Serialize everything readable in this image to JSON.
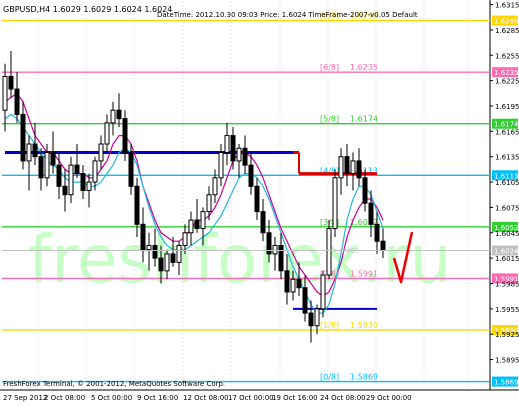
{
  "header": {
    "symbol_info": "GBPUSD,H4  1.6029 1.6029 1.6024 1.6024",
    "indicator_info": "DateTime: 2012.10.30 09:03   Price: 1.6024   TimeFrame-2007-v0.05   Default"
  },
  "footer": {
    "copyright": "FreshForex Terminal, © 2001-2012, MetaQuotes Software Corp."
  },
  "watermark": "freshforex.ru",
  "colors": {
    "background": "#ffffff",
    "candle_bull": "#000000",
    "candle_bear": "#000000",
    "level_8_8": "#ffd700",
    "level_7_8": "#ffd700",
    "level_6_8": "#ff69b4",
    "level_5_8": "#32cd32",
    "level_4_8": "#00bfff",
    "level_3_8": "#32cd32",
    "level_2_8": "#ff69b4",
    "level_1_8": "#ffd700",
    "level_0_8": "#00bfff",
    "thick_blue": "#0000cd",
    "thick_red": "#dd0000",
    "line_magenta": "#cc0099",
    "line_cyan": "#22bbdd",
    "watermark": "#7fff7f",
    "arrow": "#ee0000",
    "price_label_text": "#ffffff"
  },
  "chart_data": {
    "type": "candlestick",
    "y_range": [
      1.5859,
      1.6318
    ],
    "price_axis_ticks": [
      "1.6315",
      "1.6285",
      "1.6255",
      "1.6225",
      "1.6195",
      "1.6165",
      "1.6135",
      "1.6105",
      "1.6075",
      "1.6045",
      "1.6015",
      "1.5985",
      "1.5955",
      "1.5925",
      "1.5895"
    ],
    "time_axis_labels": [
      "27 Sep 2012",
      "2 Oct 08:00",
      "5 Oct 00:00",
      "9 Oct 16:00",
      "12 Oct 08:00",
      "17 Oct 00:00",
      "19 Oct 16:00",
      "24 Oct 08:00",
      "29 Oct 00:00"
    ],
    "murrey_levels": [
      {
        "label": "[8/8]",
        "value": "1.6296",
        "price_label": "1.6296",
        "color_key": "level_8_8"
      },
      {
        "label": "[6/8]",
        "value": "1.6235",
        "price_label": "1.6235",
        "color_key": "level_6_8"
      },
      {
        "label": "[5/8]",
        "value": "1.6174",
        "price_label": "1.6174",
        "color_key": "level_5_8"
      },
      {
        "label": "[4/8]",
        "value": "1.6113",
        "price_label": "1.6113",
        "color_key": "level_4_8"
      },
      {
        "label": "[3/8]",
        "value": "1.6052",
        "price_label": "1.6052",
        "color_key": "level_3_8"
      },
      {
        "label": "[2/8]",
        "value": "1.5991",
        "price_label": "1.5991",
        "color_key": "level_2_8"
      },
      {
        "label": "[1/8]",
        "value": "1.5930",
        "price_label": "1.5930",
        "color_key": "level_1_8"
      },
      {
        "label": "[0/8]",
        "value": "1.5869",
        "price_label": "1.5869",
        "color_key": "level_0_8"
      }
    ],
    "current_price_label": "1.6024",
    "close_label": "Close",
    "candles": [
      [
        1.619,
        1.6245,
        1.6165,
        1.623
      ],
      [
        1.623,
        1.626,
        1.6205,
        1.6215
      ],
      [
        1.6215,
        1.6235,
        1.6175,
        1.6185
      ],
      [
        1.6185,
        1.62,
        1.612,
        1.613
      ],
      [
        1.613,
        1.616,
        1.6095,
        1.615
      ],
      [
        1.615,
        1.6175,
        1.6125,
        1.6135
      ],
      [
        1.6135,
        1.6145,
        1.6095,
        1.611
      ],
      [
        1.611,
        1.615,
        1.61,
        1.614
      ],
      [
        1.614,
        1.6165,
        1.6115,
        1.6125
      ],
      [
        1.6125,
        1.614,
        1.6085,
        1.61
      ],
      [
        1.61,
        1.612,
        1.607,
        1.609
      ],
      [
        1.609,
        1.6135,
        1.608,
        1.6125
      ],
      [
        1.6125,
        1.615,
        1.611,
        1.6115
      ],
      [
        1.6115,
        1.6125,
        1.6085,
        1.6095
      ],
      [
        1.6095,
        1.6115,
        1.6075,
        1.6105
      ],
      [
        1.6105,
        1.6135,
        1.6095,
        1.613
      ],
      [
        1.613,
        1.616,
        1.612,
        1.615
      ],
      [
        1.615,
        1.6185,
        1.614,
        1.6175
      ],
      [
        1.6175,
        1.62,
        1.616,
        1.619
      ],
      [
        1.619,
        1.621,
        1.617,
        1.618
      ],
      [
        1.618,
        1.619,
        1.613,
        1.614
      ],
      [
        1.614,
        1.615,
        1.609,
        1.61
      ],
      [
        1.61,
        1.611,
        1.604,
        1.6055
      ],
      [
        1.6055,
        1.6075,
        1.601,
        1.6025
      ],
      [
        1.6025,
        1.6045,
        1.6,
        1.603
      ],
      [
        1.603,
        1.605,
        1.6005,
        1.6015
      ],
      [
        1.6015,
        1.603,
        1.5985,
        1.6
      ],
      [
        1.6,
        1.6025,
        1.599,
        1.602
      ],
      [
        1.602,
        1.604,
        1.6005,
        1.601
      ],
      [
        1.601,
        1.6035,
        1.5995,
        1.603
      ],
      [
        1.603,
        1.6055,
        1.602,
        1.6045
      ],
      [
        1.6045,
        1.607,
        1.603,
        1.606
      ],
      [
        1.606,
        1.6085,
        1.6045,
        1.605
      ],
      [
        1.605,
        1.6075,
        1.603,
        1.607
      ],
      [
        1.607,
        1.61,
        1.606,
        1.609
      ],
      [
        1.609,
        1.612,
        1.608,
        1.611
      ],
      [
        1.611,
        1.615,
        1.61,
        1.614
      ],
      [
        1.614,
        1.6175,
        1.6125,
        1.616
      ],
      [
        1.616,
        1.617,
        1.612,
        1.613
      ],
      [
        1.613,
        1.615,
        1.611,
        1.6145
      ],
      [
        1.6145,
        1.616,
        1.6115,
        1.6125
      ],
      [
        1.6125,
        1.614,
        1.609,
        1.61
      ],
      [
        1.61,
        1.611,
        1.606,
        1.607
      ],
      [
        1.607,
        1.6085,
        1.6035,
        1.6045
      ],
      [
        1.6045,
        1.606,
        1.601,
        1.602
      ],
      [
        1.602,
        1.604,
        1.6,
        1.603
      ],
      [
        1.603,
        1.6045,
        1.599,
        1.6
      ],
      [
        1.6,
        1.602,
        1.596,
        1.5975
      ],
      [
        1.5975,
        1.6,
        1.5965,
        1.599
      ],
      [
        1.599,
        1.601,
        1.597,
        1.598
      ],
      [
        1.598,
        1.5995,
        1.594,
        1.595
      ],
      [
        1.595,
        1.5965,
        1.5915,
        1.5935
      ],
      [
        1.5935,
        1.596,
        1.5925,
        1.5955
      ],
      [
        1.5955,
        1.6,
        1.5945,
        1.5995
      ],
      [
        1.5995,
        1.606,
        1.599,
        1.605
      ],
      [
        1.605,
        1.612,
        1.604,
        1.611
      ],
      [
        1.611,
        1.6145,
        1.609,
        1.6135
      ],
      [
        1.6135,
        1.615,
        1.61,
        1.6115
      ],
      [
        1.6115,
        1.614,
        1.6095,
        1.613
      ],
      [
        1.613,
        1.6145,
        1.61,
        1.611
      ],
      [
        1.611,
        1.612,
        1.607,
        1.608
      ],
      [
        1.608,
        1.6095,
        1.604,
        1.6055
      ],
      [
        1.6055,
        1.607,
        1.602,
        1.6035
      ],
      [
        1.6035,
        1.605,
        1.6015,
        1.6025
      ]
    ],
    "ma_magenta": [
      1.62,
      1.6205,
      1.621,
      1.62,
      1.618,
      1.616,
      1.615,
      1.614,
      1.614,
      1.613,
      1.612,
      1.6115,
      1.6115,
      1.6115,
      1.611,
      1.611,
      1.612,
      1.613,
      1.615,
      1.616,
      1.616,
      1.615,
      1.613,
      1.61,
      1.608,
      1.606,
      1.6045,
      1.604,
      1.6035,
      1.6035,
      1.604,
      1.605,
      1.606,
      1.606,
      1.6065,
      1.6075,
      1.609,
      1.611,
      1.613,
      1.614,
      1.614,
      1.6135,
      1.6125,
      1.611,
      1.609,
      1.607,
      1.605,
      1.6035,
      1.602,
      1.6005,
      1.5995,
      1.5985,
      1.5975,
      1.597,
      1.5975,
      1.599,
      1.601,
      1.604,
      1.606,
      1.6075,
      1.6085,
      1.6085,
      1.6075,
      1.606
    ],
    "ma_cyan": [
      1.618,
      1.6185,
      1.618,
      1.617,
      1.616,
      1.615,
      1.614,
      1.613,
      1.6125,
      1.612,
      1.611,
      1.6105,
      1.6105,
      1.6105,
      1.61,
      1.61,
      1.6105,
      1.6115,
      1.6125,
      1.614,
      1.6145,
      1.614,
      1.6125,
      1.61,
      1.6075,
      1.6055,
      1.604,
      1.603,
      1.6025,
      1.6025,
      1.6025,
      1.603,
      1.6035,
      1.604,
      1.6045,
      1.6055,
      1.6065,
      1.608,
      1.6095,
      1.611,
      1.6115,
      1.6115,
      1.611,
      1.61,
      1.6085,
      1.6065,
      1.6045,
      1.6025,
      1.6005,
      1.599,
      1.5975,
      1.596,
      1.595,
      1.595,
      1.596,
      1.5985,
      1.602,
      1.606,
      1.6085,
      1.61,
      1.61,
      1.609,
      1.607,
      1.605
    ],
    "thick_lines": [
      {
        "color_key": "thick_blue",
        "segments": [
          {
            "x0": 0,
            "x1": 48,
            "y": 1.614
          }
        ]
      },
      {
        "color_key": "thick_red",
        "segments": [
          {
            "x0": 48,
            "x1": 49,
            "y": 1.614
          },
          {
            "x0": 49,
            "x1": 62,
            "y": 1.6115
          }
        ]
      },
      {
        "color_key": "thick_blue_dash",
        "segments": [
          {
            "x0": 48,
            "x1": 62,
            "y": 1.5955
          }
        ]
      }
    ]
  }
}
